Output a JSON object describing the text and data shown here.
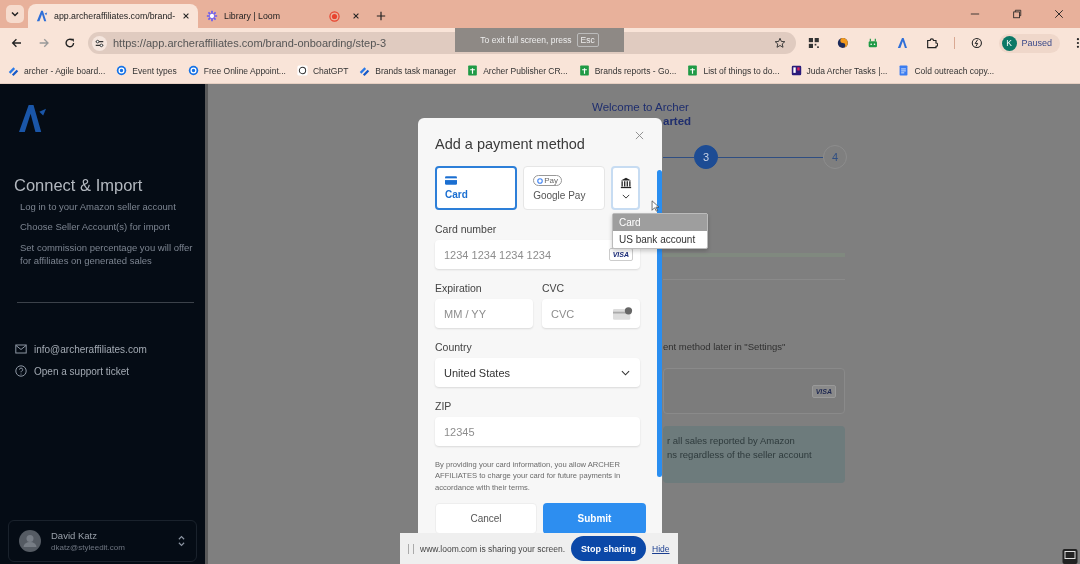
{
  "browser": {
    "tabs": [
      {
        "title": "app.archeraffiliates.com/brand-",
        "selected": true,
        "recording": false
      },
      {
        "title": "Library | Loom",
        "selected": false,
        "recording": true
      }
    ],
    "url": "https://app.archeraffiliates.com/brand-onboarding/step-3",
    "profile": {
      "initial": "K",
      "status": "Paused"
    },
    "bookmarks": [
      {
        "title": "archer - Agile board...",
        "kind": "board"
      },
      {
        "title": "Event types",
        "kind": "calendar"
      },
      {
        "title": "Free Online Appoint...",
        "kind": "calendar"
      },
      {
        "title": "ChatGPT",
        "kind": "chat"
      },
      {
        "title": "Brands task manager",
        "kind": "board"
      },
      {
        "title": "Archer Publisher CR...",
        "kind": "sheet"
      },
      {
        "title": "Brands reports - Go...",
        "kind": "sheet"
      },
      {
        "title": "List of things to do...",
        "kind": "sheet"
      },
      {
        "title": "Juda Archer Tasks |...",
        "kind": "tasks"
      },
      {
        "title": "Cold outreach copy...",
        "kind": "doc"
      }
    ]
  },
  "fullscreen_notice": {
    "text": "To exit full screen, press",
    "key": "Esc"
  },
  "sidebar": {
    "heading": "Connect & Import",
    "steps": [
      "Log in to your Amazon seller account",
      "Choose Seller Account(s) for import",
      "Set commission percentage you will offer for affiliates on generated sales"
    ],
    "contacts": [
      {
        "kind": "email",
        "text": "info@archeraffiliates.com"
      },
      {
        "kind": "help",
        "text": "Open a support ticket"
      }
    ],
    "user": {
      "name": "David Katz",
      "email": "dkatz@styleedit.com"
    }
  },
  "background": {
    "title": "Welcome to Archer",
    "subtitle": "arted",
    "steps": [
      {
        "label": "3",
        "current": true
      },
      {
        "label": "4",
        "current": false
      }
    ],
    "note": "ent method later in \"Settings\"",
    "card_badge": "VISA",
    "info": [
      "r all sales reported by Amazon",
      "ns regardless of the seller account"
    ]
  },
  "modal": {
    "title": "Add a payment method",
    "methods": [
      {
        "kind": "card",
        "label": "Card",
        "selected": true
      },
      {
        "kind": "gpay",
        "label": "Google Pay",
        "badge": "Pay",
        "selected": false
      }
    ],
    "menu": [
      {
        "label": "Card",
        "selected": true
      },
      {
        "label": "US bank account",
        "selected": false
      }
    ],
    "card_number": {
      "label": "Card number",
      "placeholder": "1234 1234 1234 1234",
      "badge": "VISA"
    },
    "expiration": {
      "label": "Expiration",
      "placeholder": "MM / YY"
    },
    "cvc": {
      "label": "CVC",
      "placeholder": "CVC"
    },
    "country": {
      "label": "Country",
      "value": "United States"
    },
    "zip": {
      "label": "ZIP",
      "placeholder": "12345"
    },
    "disclaimer": "By providing your card information, you allow ARCHER AFFILIATES to charge your card for future payments in accordance with their terms.",
    "cancel": "Cancel",
    "submit": "Submit"
  },
  "sharing_bar": {
    "text": "www.loom.com is sharing your screen.",
    "stop": "Stop sharing",
    "hide": "Hide"
  }
}
